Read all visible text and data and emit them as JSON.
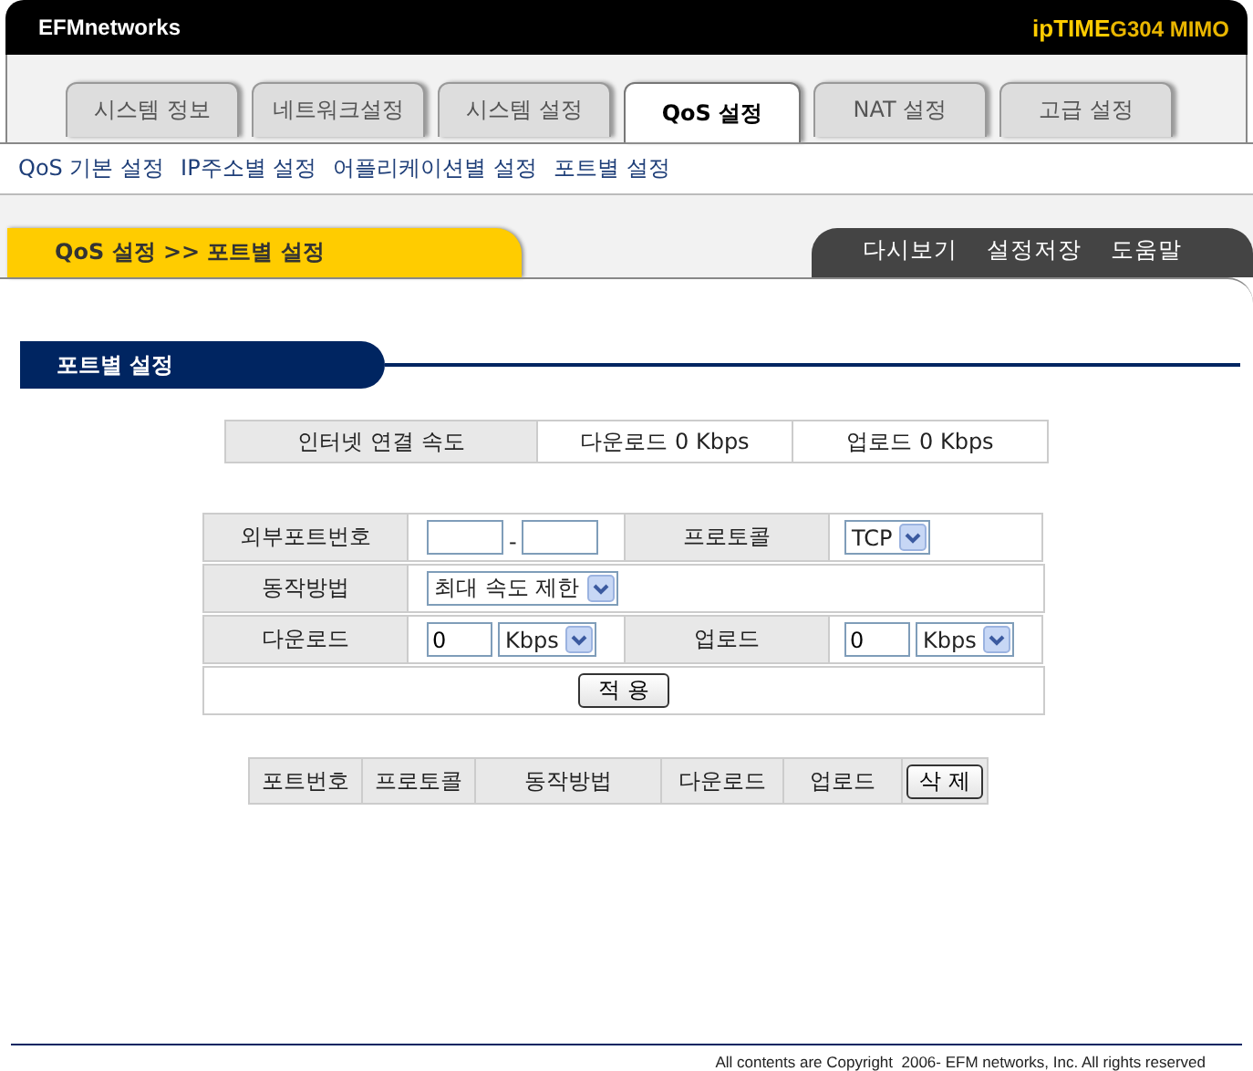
{
  "header": {
    "brand": "EFMnetworks",
    "product_name": "ipTIME",
    "product_model": "G304 MIMO"
  },
  "tabs": [
    {
      "label": "시스템 정보",
      "selected": false
    },
    {
      "label": "네트워크설정",
      "selected": false
    },
    {
      "label": "시스템 설정",
      "selected": false
    },
    {
      "label": "QoS 설정",
      "selected": true
    },
    {
      "label": "NAT 설정",
      "selected": false
    },
    {
      "label": "고급 설정",
      "selected": false
    }
  ],
  "subnav": [
    "QoS 기본 설정",
    "IP주소별 설정",
    "어플리케이션별 설정",
    "포트별 설정"
  ],
  "breadcrumb": "QoS 설정 >> 포트별 설정",
  "actions": [
    "다시보기",
    "설정저장",
    "도움말"
  ],
  "section_title": "포트별 설정",
  "speed": {
    "label": "인터넷 연결 속도",
    "download": "다운로드 0 Kbps",
    "upload": "업로드 0 Kbps"
  },
  "form": {
    "port_label": "외부포트번호",
    "port_separator": "-",
    "protocol_label": "프로토콜",
    "protocol": "TCP",
    "mode_label": "동작방법",
    "mode": "최대 속도 제한",
    "download_label": "다운로드",
    "download_value": "0",
    "download_unit": "Kbps",
    "upload_label": "업로드",
    "upload_value": "0",
    "upload_unit": "Kbps",
    "apply": "적 용"
  },
  "list": {
    "columns": [
      "포트번호",
      "프로토콜",
      "동작방법",
      "다운로드",
      "업로드"
    ],
    "delete": "삭 제"
  },
  "footer": "All contents are Copyright  2006- EFM networks, Inc. All rights reserved"
}
